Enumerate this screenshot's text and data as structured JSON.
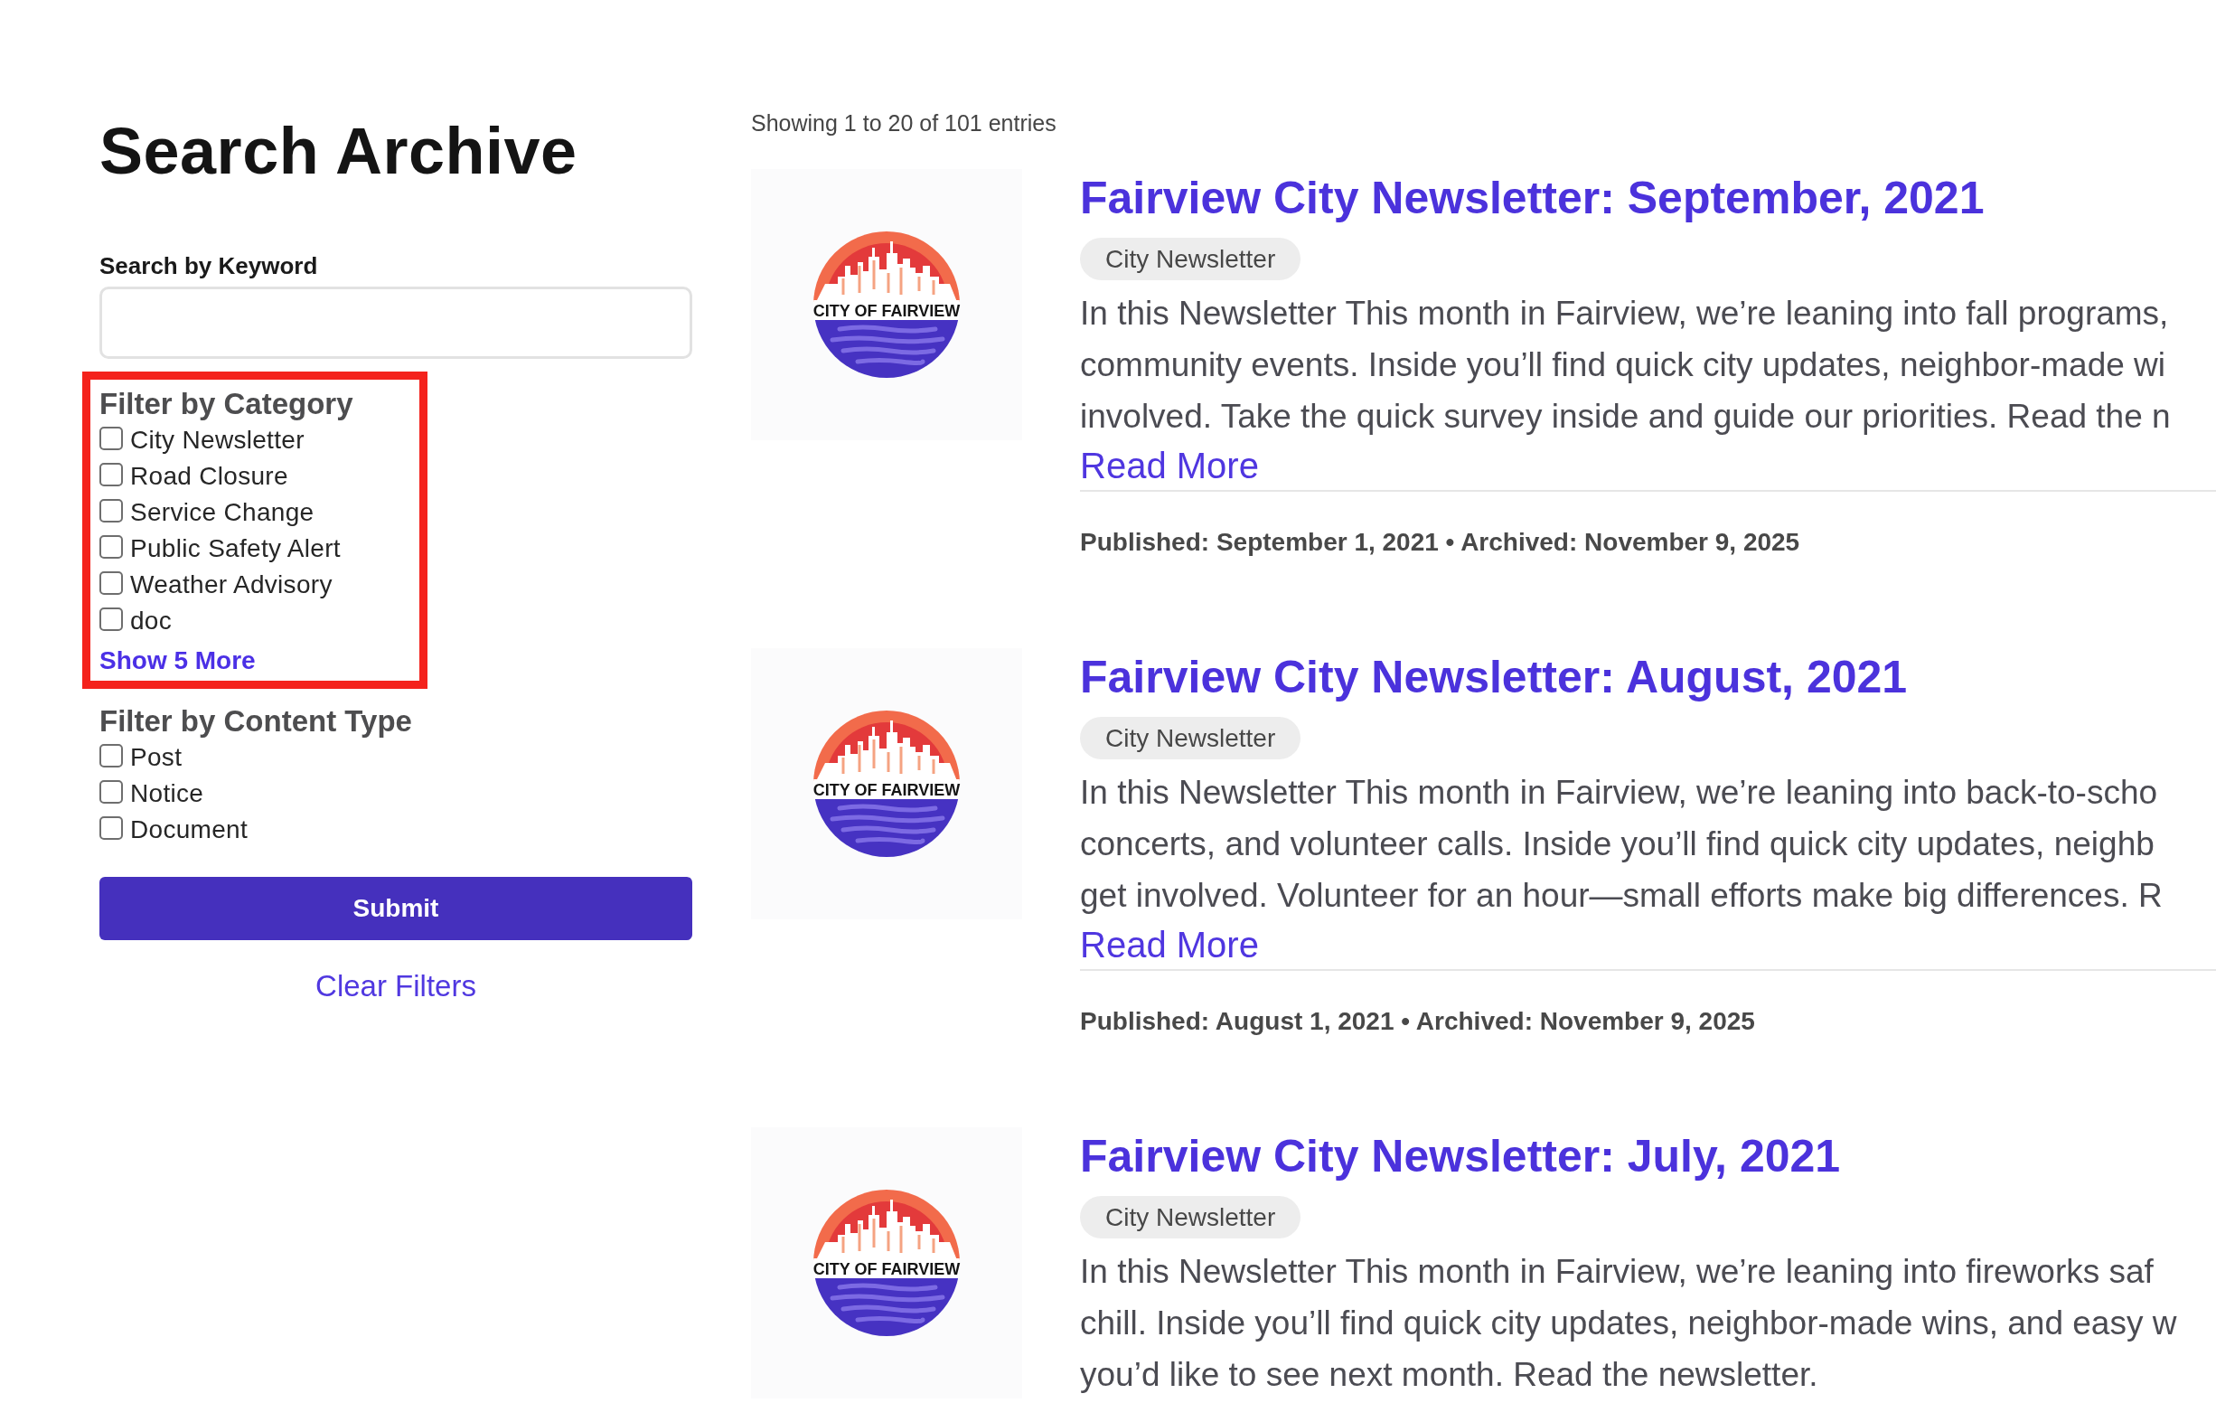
{
  "sidebar": {
    "title": "Search Archive",
    "keyword": {
      "label": "Search by Keyword"
    },
    "filter_groups": [
      {
        "title": "Filter by Category",
        "highlighted": true,
        "options": [
          {
            "label": "City Newsletter",
            "checked": false
          },
          {
            "label": "Road Closure",
            "checked": false
          },
          {
            "label": "Service Change",
            "checked": false
          },
          {
            "label": "Public Safety Alert",
            "checked": false
          },
          {
            "label": "Weather Advisory",
            "checked": false
          },
          {
            "label": "doc",
            "checked": false
          }
        ],
        "more_link": "Show 5 More"
      },
      {
        "title": "Filter by Content Type",
        "highlighted": false,
        "options": [
          {
            "label": "Post",
            "checked": false
          },
          {
            "label": "Notice",
            "checked": false
          },
          {
            "label": "Document",
            "checked": false
          }
        ]
      }
    ],
    "submit": "Submit",
    "clear": "Clear Filters"
  },
  "results": {
    "summary": "Showing 1 to 20 of 101 entries",
    "articles": [
      {
        "logo_text": "CITY OF FAIRVIEW",
        "title": "Fairview City Newsletter: September, 2021",
        "tag": "City Newsletter",
        "excerpt": [
          "In this Newsletter This month in Fairview, we’re leaning into fall programs,",
          "community events. Inside you’ll find quick city updates, neighbor-made wi",
          "involved. Take the quick survey inside and guide our priorities. Read the n"
        ],
        "read_more": "Read More",
        "meta": "Published: September 1, 2021 • Archived: November 9, 2025"
      },
      {
        "logo_text": "CITY OF FAIRVIEW",
        "title": "Fairview City Newsletter: August, 2021",
        "tag": "City Newsletter",
        "excerpt": [
          "In this Newsletter This month in Fairview, we’re leaning into back-to-scho",
          "concerts, and volunteer calls. Inside you’ll find quick city updates, neighb",
          "get involved. Volunteer for an hour—small efforts make big differences. R"
        ],
        "read_more": "Read More",
        "meta": "Published: August 1, 2021 • Archived: November 9, 2025"
      },
      {
        "logo_text": "CITY OF FAIRVIEW",
        "title": "Fairview City Newsletter: July, 2021",
        "tag": "City Newsletter",
        "excerpt": [
          "In this Newsletter This month in Fairview, we’re leaning into fireworks saf",
          "chill. Inside you’ll find quick city updates, neighbor-made wins, and easy w",
          "you’d like to see next month. Read the newsletter."
        ]
      }
    ]
  }
}
